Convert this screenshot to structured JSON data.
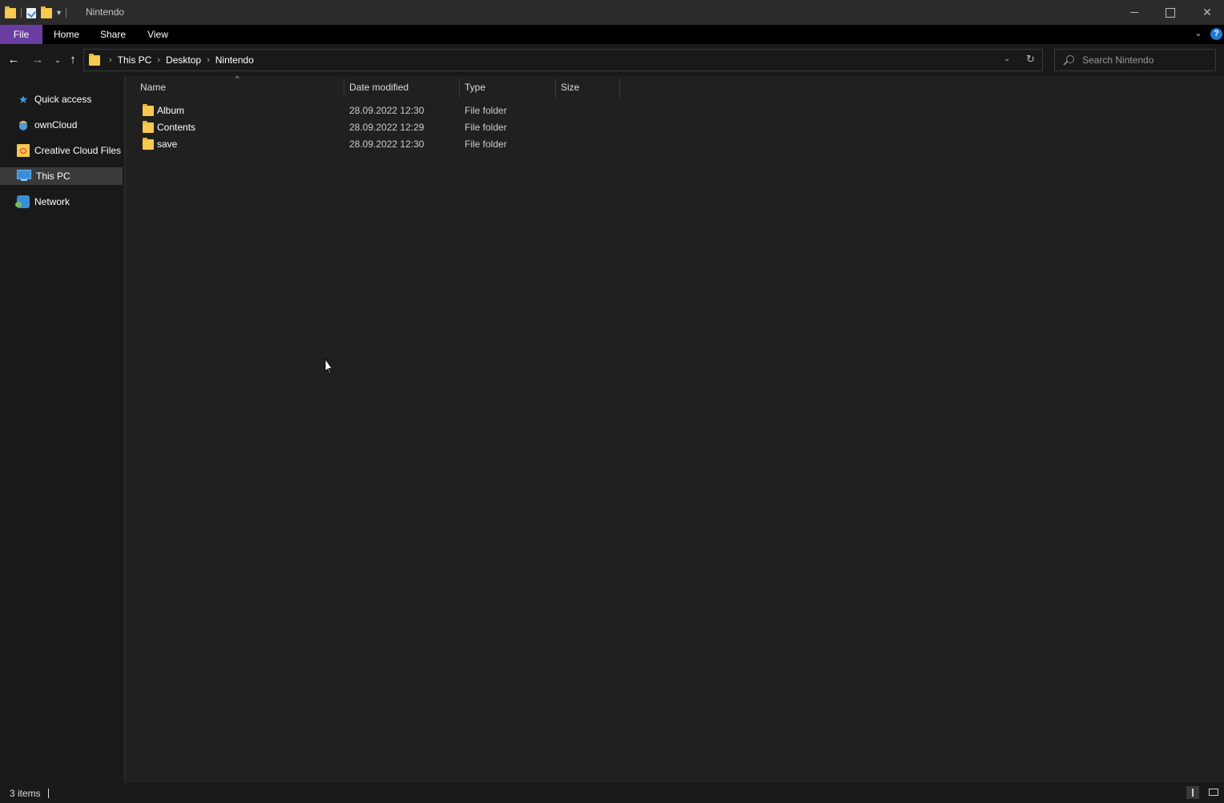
{
  "window": {
    "title": "Nintendo"
  },
  "ribbon": {
    "tabs": [
      "File",
      "Home",
      "Share",
      "View"
    ],
    "accent_color": "#6a3ea1",
    "help_label": "?"
  },
  "address": {
    "crumbs": [
      "This PC",
      "Desktop",
      "Nintendo"
    ]
  },
  "search": {
    "placeholder": "Search Nintendo"
  },
  "sidebar": {
    "items": [
      {
        "label": "Quick access",
        "icon": "star-icon"
      },
      {
        "label": "ownCloud",
        "icon": "owncloud-icon"
      },
      {
        "label": "Creative Cloud Files",
        "icon": "creative-cloud-icon"
      },
      {
        "label": "This PC",
        "icon": "computer-icon",
        "selected": true
      },
      {
        "label": "Network",
        "icon": "network-icon"
      }
    ]
  },
  "columns": {
    "name": "Name",
    "date": "Date modified",
    "type": "Type",
    "size": "Size"
  },
  "files": [
    {
      "name": "Album",
      "date": "28.09.2022 12:30",
      "type": "File folder",
      "size": ""
    },
    {
      "name": "Contents",
      "date": "28.09.2022 12:29",
      "type": "File folder",
      "size": ""
    },
    {
      "name": "save",
      "date": "28.09.2022 12:30",
      "type": "File folder",
      "size": ""
    }
  ],
  "status": {
    "items_count": "3 items"
  }
}
